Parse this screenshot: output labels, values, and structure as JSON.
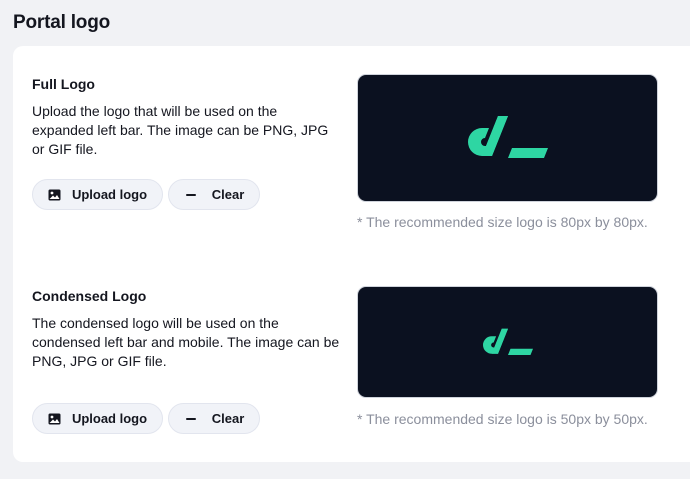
{
  "section": {
    "title": "Portal logo"
  },
  "full_logo": {
    "label": "Full Logo",
    "description": "Upload the logo that will be used on the expanded left bar. The image can be PNG, JPG or GIF file.",
    "upload_label": "Upload logo",
    "clear_label": "Clear",
    "hint": "* The recommended size logo is 80px by 80px."
  },
  "condensed_logo": {
    "label": "Condensed Logo",
    "description": "The condensed logo will be used on the condensed left bar and mobile. The image can be PNG, JPG or GIF file.",
    "upload_label": "Upload logo",
    "clear_label": "Clear",
    "hint": "* The recommended size logo is 50px by 50px."
  },
  "icons": {
    "upload": "image-icon",
    "clear": "minus-icon",
    "logo": "brand-logo"
  },
  "colors": {
    "preview_bg": "#0b1120",
    "logo_accent": "#2ed6a3",
    "button_bg": "#f1f3f8",
    "hint_text": "#8b8f9c"
  }
}
